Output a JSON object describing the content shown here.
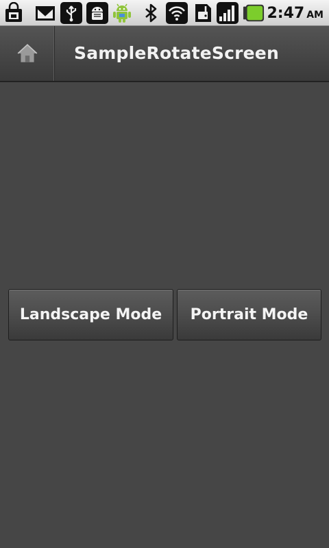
{
  "status_bar": {
    "icons": [
      "shopping-bag-icon",
      "gmail-icon",
      "usb-icon",
      "android-debug-icon",
      "android-mascot-icon",
      "bluetooth-icon",
      "wifi-icon",
      "sim-alert-icon",
      "signal-icon",
      "battery-icon"
    ],
    "time": "2:47",
    "ampm": "AM"
  },
  "action_bar": {
    "home_icon": "home-icon",
    "title": "SampleRotateScreen"
  },
  "buttons": {
    "landscape_label": "Landscape Mode",
    "portrait_label": "Portrait Mode"
  },
  "colors": {
    "background": "#464646",
    "battery": "#7ccd2c",
    "android_green": "#8fc43a"
  }
}
